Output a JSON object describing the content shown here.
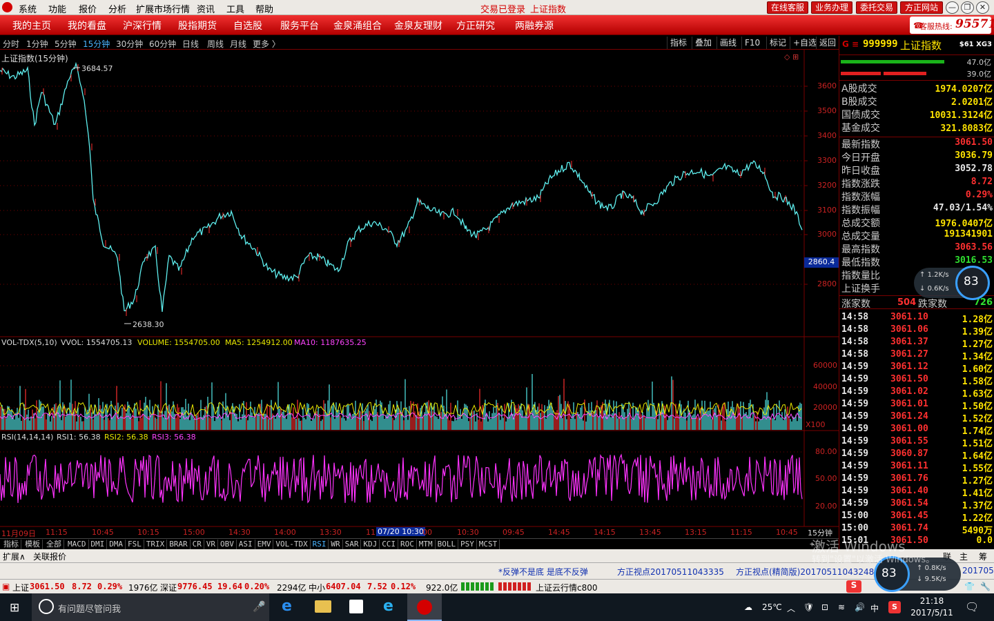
{
  "titlebar": {
    "menus": [
      "系统",
      "功能",
      "报价",
      "分析",
      "扩展市场行情",
      "资讯",
      "工具",
      "帮助"
    ],
    "trade_status": "交易已登录",
    "current_index": "上证指数",
    "buttons": [
      "在线客服",
      "业务办理",
      "委托交易",
      "方正网站"
    ],
    "window_controls": [
      "—",
      "❐",
      "✕"
    ]
  },
  "navbar": {
    "items": [
      "我的主页",
      "我的看盘",
      "沪深行情",
      "股指期货",
      "自选股",
      "服务平台",
      "金泉涌组合",
      "金泉友理财",
      "方正研究",
      "两融券源"
    ],
    "hotline_label": "客服热线:",
    "hotline_number": "95571"
  },
  "periods": {
    "items": [
      "分时",
      "1分钟",
      "5分钟",
      "15分钟",
      "30分钟",
      "60分钟",
      "日线",
      "周线",
      "月线",
      "更多 〉"
    ],
    "active_index": 3,
    "tools": [
      "指标",
      "叠加",
      "画线",
      "F10",
      "标记",
      "+自选",
      "返回"
    ]
  },
  "main_chart": {
    "title": "上证指数(15分钟)",
    "high_label": "3684.57",
    "low_label": "2638.30",
    "y_ticks": [
      "3600",
      "3500",
      "3400",
      "3300",
      "3200",
      "3100",
      "3000",
      "2800"
    ],
    "cursor_price": "2860.4",
    "colors": {
      "candle": "#5ff0f0",
      "grid": "#7a0000",
      "axis_text": "#cc2222"
    }
  },
  "volume_panel": {
    "name": "VOL-TDX(5,10)",
    "vvol": "VVOL: 1554705.13",
    "volume": "VOLUME: 1554705.00",
    "ma5": "MA5: 1254912.00",
    "ma10": "MA10: 1187635.25",
    "y_ticks": [
      "60000",
      "40000",
      "20000"
    ],
    "unit": "X100"
  },
  "rsi_panel": {
    "name": "RSI(14,14,14)",
    "rsi1": "RSI1: 56.38",
    "rsi2": "RSI2: 56.38",
    "rsi3": "RSI3: 56.38",
    "y_ticks": [
      "80.00",
      "50.00",
      "20.00"
    ]
  },
  "time_axis": {
    "labels": [
      "11月09日",
      "11:15",
      "10:45",
      "10:15",
      "15:00",
      "14:30",
      "14:00",
      "13:30",
      "11",
      "00",
      "10:30",
      "09:45",
      "14:45",
      "14:15",
      "13:45",
      "13:15",
      "11:15",
      "10:45"
    ],
    "cursor_time": "07/20 10:30",
    "period_label": "15分钟"
  },
  "bottom_tabs": [
    "指标",
    "模板",
    "全部",
    "MACD",
    "DMI",
    "DMA",
    "FSL",
    "TRIX",
    "BRAR",
    "CR",
    "VR",
    "OBV",
    "ASI",
    "EMV",
    "VOL-TDX",
    "RSI",
    "WR",
    "SAR",
    "KDJ",
    "CCI",
    "ROC",
    "MTM",
    "BOLL",
    "PSY",
    "MCST"
  ],
  "bottom_active": "RSI",
  "right_panel": {
    "code": "999999",
    "name": "上证指数",
    "tag": "$61 XG3",
    "bar1_value": "47.0亿",
    "bar2_value": "39.0亿",
    "turnover": [
      {
        "k": "A股成交",
        "v": "1974.0207亿"
      },
      {
        "k": "B股成交",
        "v": "2.0201亿"
      },
      {
        "k": "国债成交",
        "v": "10031.3124亿"
      },
      {
        "k": "基金成交",
        "v": "321.8083亿"
      }
    ],
    "quote": [
      {
        "k": "最新指数",
        "v": "3061.50",
        "c": "red"
      },
      {
        "k": "今日开盘",
        "v": "3036.79",
        "c": "yellow"
      },
      {
        "k": "昨日收盘",
        "v": "3052.78",
        "c": "white"
      },
      {
        "k": "指数涨跌",
        "v": "8.72",
        "c": "red"
      },
      {
        "k": "指数涨幅",
        "v": "0.29%",
        "c": "red"
      },
      {
        "k": "指数振幅",
        "v": "47.03/1.54%",
        "c": "white"
      },
      {
        "k": "总成交额",
        "v": "1976.0407亿",
        "c": "yellow"
      },
      {
        "k": "总成交量",
        "v": "191341901",
        "c": "yellow"
      },
      {
        "k": "最高指数",
        "v": "3063.56",
        "c": "red"
      },
      {
        "k": "最低指数",
        "v": "3016.53",
        "c": "green"
      },
      {
        "k": "指数量比",
        "v": "",
        "c": "white"
      },
      {
        "k": "上证换手",
        "v": "",
        "c": "white"
      }
    ],
    "up_label": "涨家数",
    "up_count": "504",
    "down_label": "跌家数",
    "down_count": "726",
    "ticks": [
      {
        "t": "14:58",
        "p": "3061.10",
        "v": "1.28亿"
      },
      {
        "t": "14:58",
        "p": "3061.06",
        "v": "1.39亿"
      },
      {
        "t": "14:58",
        "p": "3061.37",
        "v": "1.27亿"
      },
      {
        "t": "14:58",
        "p": "3061.27",
        "v": "1.34亿"
      },
      {
        "t": "14:59",
        "p": "3061.12",
        "v": "1.60亿"
      },
      {
        "t": "14:59",
        "p": "3061.50",
        "v": "1.58亿"
      },
      {
        "t": "14:59",
        "p": "3061.02",
        "v": "1.63亿"
      },
      {
        "t": "14:59",
        "p": "3061.01",
        "v": "1.50亿"
      },
      {
        "t": "14:59",
        "p": "3061.24",
        "v": "1.52亿"
      },
      {
        "t": "14:59",
        "p": "3061.00",
        "v": "1.74亿"
      },
      {
        "t": "14:59",
        "p": "3061.55",
        "v": "1.51亿"
      },
      {
        "t": "14:59",
        "p": "3060.87",
        "v": "1.64亿"
      },
      {
        "t": "14:59",
        "p": "3061.11",
        "v": "1.55亿"
      },
      {
        "t": "14:59",
        "p": "3061.76",
        "v": "1.27亿"
      },
      {
        "t": "14:59",
        "p": "3061.40",
        "v": "1.41亿"
      },
      {
        "t": "14:59",
        "p": "3061.54",
        "v": "1.37亿"
      },
      {
        "t": "15:00",
        "p": "3061.45",
        "v": "1.22亿"
      },
      {
        "t": "15:00",
        "p": "3061.74",
        "v": "5490万"
      },
      {
        "t": "15:01",
        "p": "3061.50",
        "v": "0.0"
      }
    ],
    "net_up": "1.2K/s",
    "net_down": "0.6K/s",
    "net_pct": "83"
  },
  "ext_bar": {
    "a": "扩展∧",
    "b": "关联报价"
  },
  "news_bar": {
    "a": "*反弹不是底  是底不反弹",
    "b": "方正视点20170511043335",
    "c": "方正视点(精简版)20170511043248",
    "d": "2017051"
  },
  "index_bar": {
    "sh_label": "上证",
    "sh_val": "3061.50",
    "sh_chg": "8.72",
    "sh_pct": "0.29%",
    "sh_amt": "1976亿",
    "sz_label": "深证",
    "sz_val": "9776.45",
    "sz_chg": "19.64",
    "sz_pct": "0.20%",
    "sz_amt": "2294亿",
    "zx_label": "中小",
    "zx_val": "6407.04",
    "zx_chg": "7.52",
    "zx_pct": "0.12%",
    "zx_amt": "922.0亿",
    "cloud": "上证云行情c800"
  },
  "gauge2": {
    "up": "0.8K/s",
    "down": "9.5K/s",
    "pct": "83"
  },
  "watermark": {
    "line1": "激活 Windows",
    "line2": "转到\"设置\"以激活 Windows。"
  },
  "taskbar": {
    "search_placeholder": "有问题尽管问我",
    "temp": "25℃",
    "ime": "中",
    "time": "21:18",
    "date": "2017/5/11"
  }
}
